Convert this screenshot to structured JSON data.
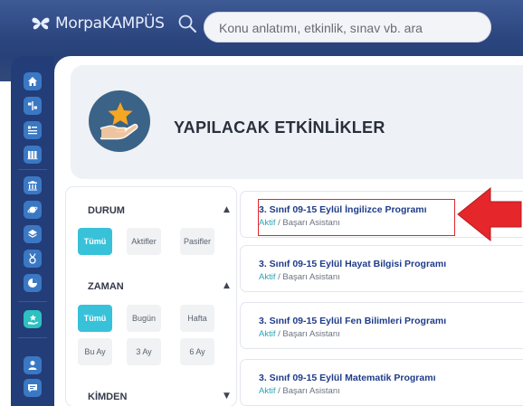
{
  "app": {
    "logo_text": "MorpaKAMPÜS",
    "brand_color": "#233d78",
    "accent_color": "#37c2d9",
    "highlight_color": "#e0262a"
  },
  "search": {
    "placeholder": "Konu anlatımı, etkinlik, sınav vb. ara",
    "value": ""
  },
  "sidebar": {
    "items": [
      {
        "icon": "home-icon"
      },
      {
        "icon": "split-icon"
      },
      {
        "icon": "document-list-icon"
      },
      {
        "icon": "books-icon"
      },
      {
        "icon": "building-icon"
      },
      {
        "icon": "planet-icon"
      },
      {
        "icon": "layers-icon"
      },
      {
        "icon": "medal-icon"
      },
      {
        "icon": "pie-chart-icon"
      },
      {
        "icon": "star-hand-icon",
        "active": true
      },
      {
        "icon": "user-icon"
      },
      {
        "icon": "chat-icon"
      }
    ]
  },
  "header": {
    "title": "YAPILACAK ETKİNLİKLER",
    "icon": "hand-star-icon"
  },
  "filters": {
    "durum": {
      "title": "DURUM",
      "arrow": "▲",
      "options": [
        "Tümü",
        "Aktifler",
        "Pasifler"
      ],
      "selected": "Tümü"
    },
    "zaman": {
      "title": "ZAMAN",
      "arrow": "▲",
      "options": [
        "Tümü",
        "Bugün",
        "Hafta",
        "Bu Ay",
        "3 Ay",
        "6 Ay"
      ],
      "selected": "Tümü"
    },
    "kimden": {
      "title": "KİMDEN",
      "arrow": "▼"
    }
  },
  "activities": [
    {
      "title": "3. Sınıf 09-15 Eylül İngilizce Programı",
      "status": "Aktif",
      "source": " / Başarı Asistanı",
      "highlighted": true
    },
    {
      "title": "3. Sınıf 09-15 Eylül Hayat Bilgisi Programı",
      "status": "Aktif",
      "source": " / Başarı Asistanı"
    },
    {
      "title": "3. Sınıf 09-15 Eylül Fen Bilimleri Programı",
      "status": "Aktif",
      "source": " / Başarı Asistanı"
    },
    {
      "title": "3. Sınıf 09-15 Eylül Matematik Programı",
      "status": "Aktif",
      "source": " / Başarı Asistanı"
    }
  ]
}
